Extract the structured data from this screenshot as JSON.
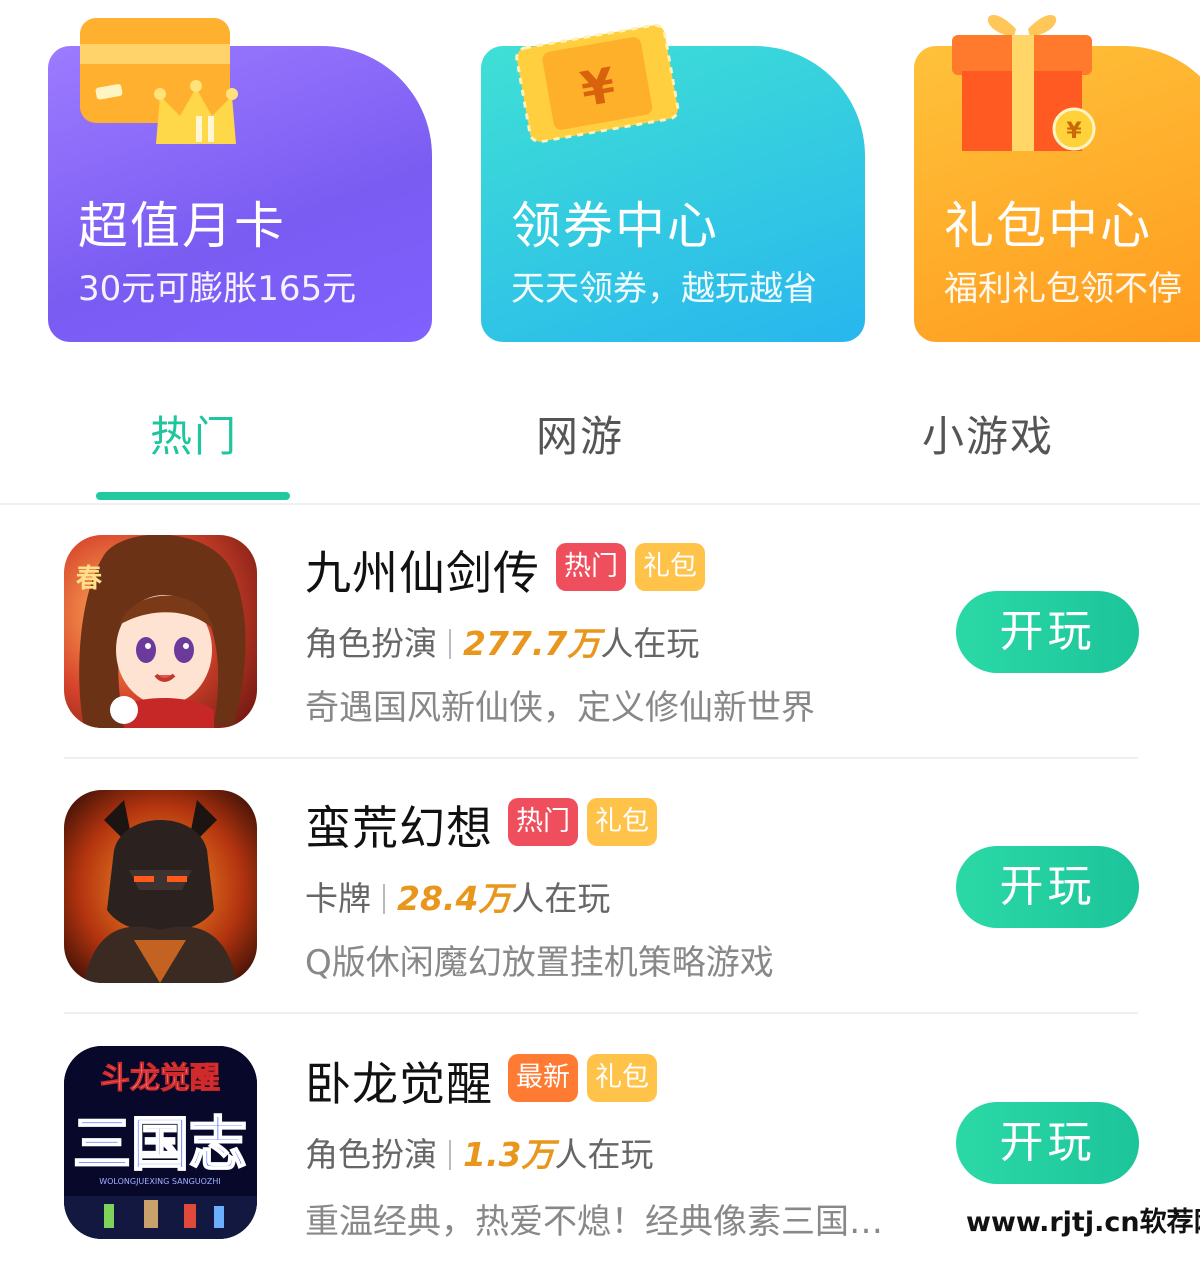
{
  "promo_cards": [
    {
      "title": "超值月卡",
      "subtitle": "30元可膨胀165元",
      "icon": "card-crown-icon"
    },
    {
      "title": "领券中心",
      "subtitle": "天天领券，越玩越省",
      "icon": "coupon-ticket-icon"
    },
    {
      "title": "礼包中心",
      "subtitle": "福利礼包领不停",
      "icon": "gift-box-icon"
    }
  ],
  "tabs": [
    {
      "label": "热门",
      "active": true
    },
    {
      "label": "网游",
      "active": false
    },
    {
      "label": "小游戏",
      "active": false
    }
  ],
  "games": [
    {
      "name": "九州仙剑传",
      "tags": [
        "热门",
        "礼包"
      ],
      "genre": "角色扮演",
      "players_count": "277.7万",
      "players_suffix": "人在玩",
      "description": "奇遇国风新仙侠，定义修仙新世界",
      "button": "开玩",
      "icon": "anime-girl-icon"
    },
    {
      "name": "蛮荒幻想",
      "tags": [
        "热门",
        "礼包"
      ],
      "genre": "卡牌",
      "players_count": "28.4万",
      "players_suffix": "人在玩",
      "description": "Q版休闲魔幻放置挂机策略游戏",
      "button": "开玩",
      "icon": "dark-knight-icon"
    },
    {
      "name": "卧龙觉醒",
      "tags": [
        "最新",
        "礼包"
      ],
      "genre": "角色扮演",
      "players_count": "1.3万",
      "players_suffix": "人在玩",
      "description": "重温经典，热爱不熄！经典像素三国…",
      "button": "开玩",
      "icon": "pixel-sanguo-icon",
      "icon_text_top": "斗龙觉醒",
      "icon_text_main": "三国志",
      "icon_text_small": "WOLONGJUEXING SANGUOZHI"
    }
  ],
  "watermark": "www.rjtj.cn软荐网",
  "colors": {
    "accent": "#1fc59c",
    "hot_tag": "#ef4f5c",
    "new_tag": "#ff7a32",
    "gift_tag": "#ffc34a",
    "players": "#e8961c"
  }
}
